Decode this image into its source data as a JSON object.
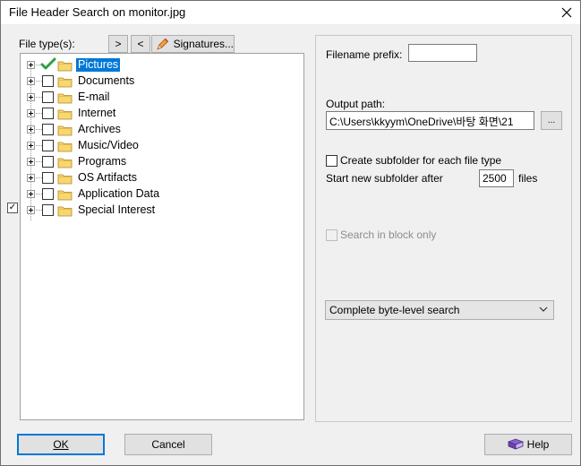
{
  "window": {
    "title": "File Header Search on monitor.jpg"
  },
  "left": {
    "file_types_label": "File type(s):",
    "btn_next": ">",
    "btn_prev": "<",
    "btn_signatures": "Signatures...",
    "tree": [
      {
        "label": "Pictures",
        "checked": true,
        "selected": true
      },
      {
        "label": "Documents",
        "checked": false,
        "selected": false
      },
      {
        "label": "E-mail",
        "checked": false,
        "selected": false
      },
      {
        "label": "Internet",
        "checked": false,
        "selected": false
      },
      {
        "label": "Archives",
        "checked": false,
        "selected": false
      },
      {
        "label": "Music/Video",
        "checked": false,
        "selected": false
      },
      {
        "label": "Programs",
        "checked": false,
        "selected": false
      },
      {
        "label": "OS Artifacts",
        "checked": false,
        "selected": false
      },
      {
        "label": "Application Data",
        "checked": false,
        "selected": false
      },
      {
        "label": "Special Interest",
        "checked": false,
        "selected": false
      }
    ]
  },
  "right": {
    "filename_prefix_label": "Filename prefix:",
    "filename_prefix_value": "",
    "output_path_label": "Output path:",
    "output_path_value": "C:\\Users\\kkyym\\OneDrive\\바탕 화면\\21",
    "browse_label": "...",
    "create_subfolder_label": "Create subfolder for each file type",
    "start_new_label": "Start new subfolder after",
    "start_new_value": "2500",
    "files_label": "files",
    "search_block_label": "Search in block only",
    "search_mode_value": "Complete byte-level search"
  },
  "footer": {
    "ok_label": "OK",
    "cancel_label": "Cancel",
    "help_label": "Help"
  },
  "colors": {
    "selection": "#0078d7",
    "folder": "#f5d46b",
    "check": "#2ea043"
  }
}
